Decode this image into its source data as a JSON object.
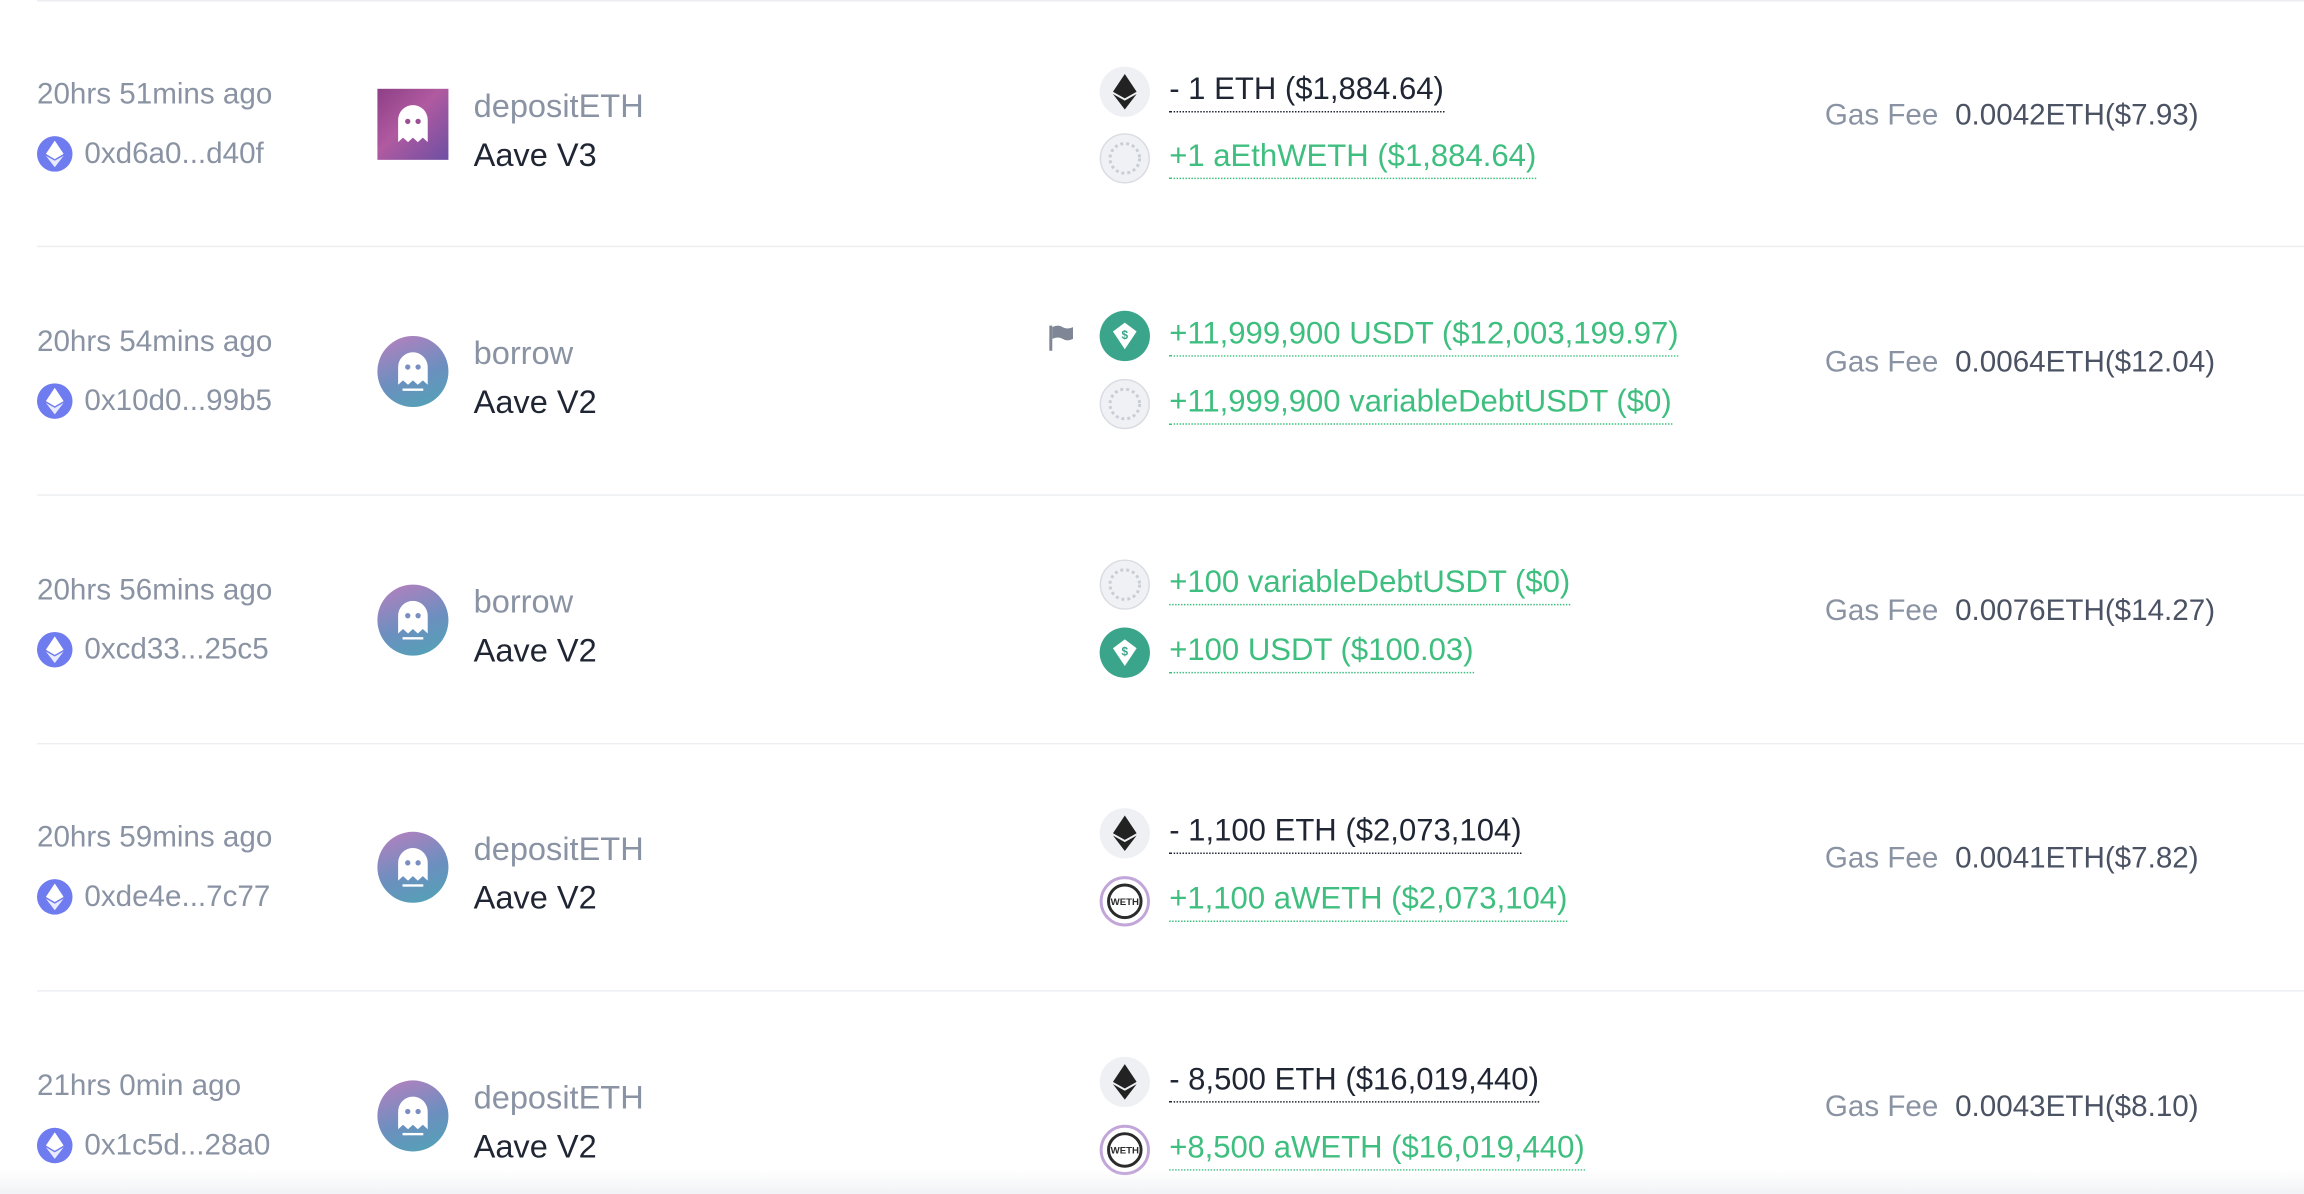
{
  "gas_label": "Gas Fee",
  "transactions": [
    {
      "time": "20hrs 51mins ago",
      "hash": "0xd6a0...d40f",
      "logo": "aave-ghost-icon",
      "method": "depositETH",
      "protocol": "Aave V3",
      "flagged": false,
      "tokens": [
        {
          "icon": "eth-icon",
          "amount": "- 1 ETH ($1,884.64)",
          "direction": "out"
        },
        {
          "icon": "generic-token-icon",
          "amount": "+1 aEthWETH ($1,884.64)",
          "direction": "in"
        }
      ],
      "gas": "0.0042ETH($7.93)"
    },
    {
      "time": "20hrs 54mins ago",
      "hash": "0x10d0...99b5",
      "logo": "aave-ghost-icon",
      "method": "borrow",
      "protocol": "Aave V2",
      "flagged": true,
      "tokens": [
        {
          "icon": "usdt-icon",
          "amount": "+11,999,900 USDT ($12,003,199.97)",
          "direction": "in"
        },
        {
          "icon": "generic-token-icon",
          "amount": "+11,999,900 variableDebtUSDT ($0)",
          "direction": "in"
        }
      ],
      "gas": "0.0064ETH($12.04)"
    },
    {
      "time": "20hrs 56mins ago",
      "hash": "0xcd33...25c5",
      "logo": "aave-ghost-icon",
      "method": "borrow",
      "protocol": "Aave V2",
      "flagged": false,
      "tokens": [
        {
          "icon": "generic-token-icon",
          "amount": "+100 variableDebtUSDT ($0)",
          "direction": "in"
        },
        {
          "icon": "usdt-icon",
          "amount": "+100 USDT ($100.03)",
          "direction": "in"
        }
      ],
      "gas": "0.0076ETH($14.27)"
    },
    {
      "time": "20hrs 59mins ago",
      "hash": "0xde4e...7c77",
      "logo": "aave-ghost-icon",
      "method": "depositETH",
      "protocol": "Aave V2",
      "flagged": false,
      "tokens": [
        {
          "icon": "eth-icon",
          "amount": "- 1,100 ETH ($2,073,104)",
          "direction": "out"
        },
        {
          "icon": "weth-icon",
          "amount": "+1,100 aWETH ($2,073,104)",
          "direction": "in"
        }
      ],
      "gas": "0.0041ETH($7.82)"
    },
    {
      "time": "21hrs 0min ago",
      "hash": "0x1c5d...28a0",
      "logo": "aave-ghost-icon",
      "method": "depositETH",
      "protocol": "Aave V2",
      "flagged": false,
      "tokens": [
        {
          "icon": "eth-icon",
          "amount": "- 8,500 ETH ($16,019,440)",
          "direction": "out"
        },
        {
          "icon": "weth-icon",
          "amount": "+8,500 aWETH ($16,019,440)",
          "direction": "in"
        }
      ],
      "gas": "0.0043ETH($8.10)"
    }
  ],
  "colors": {
    "positive": "#3fbf7f",
    "negative": "#1f2533",
    "muted": "#8a93a3",
    "usdt": "#3aa58b",
    "chain_badge": "#6f7cf0"
  }
}
